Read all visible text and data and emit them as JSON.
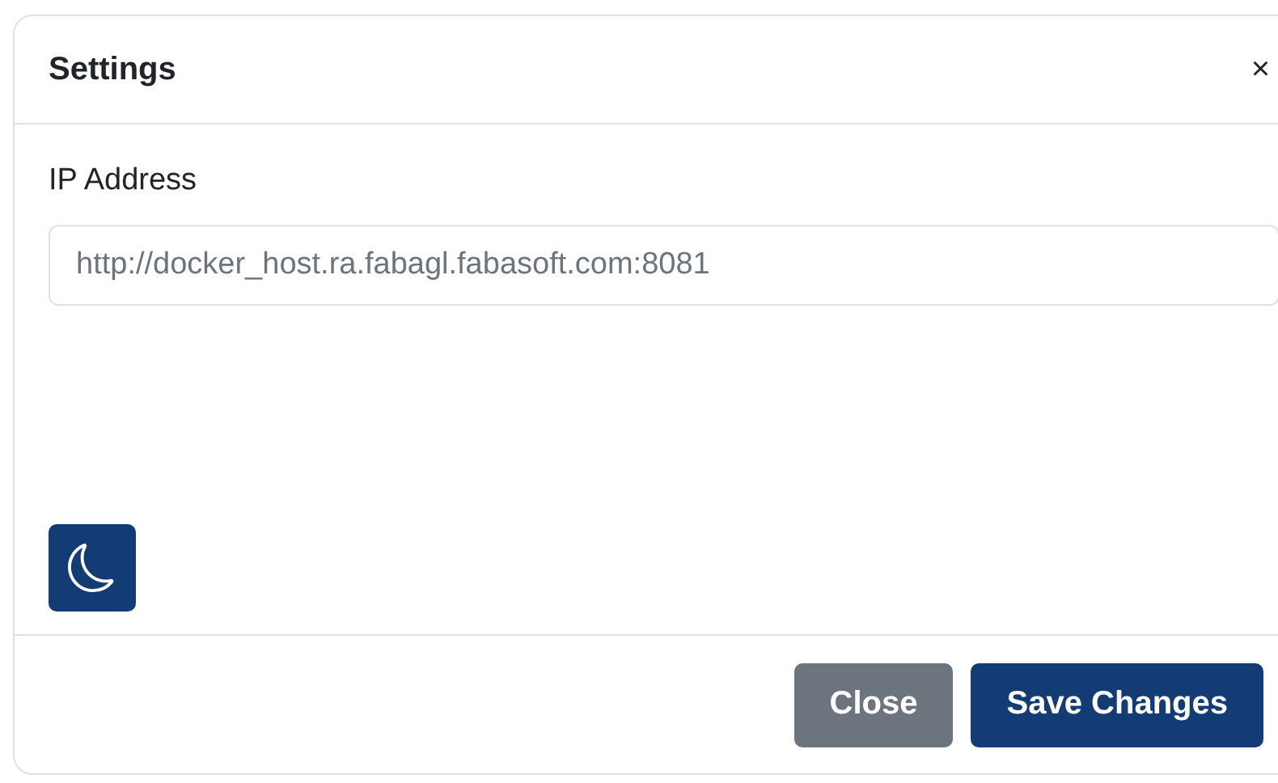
{
  "dialog": {
    "title": "Settings",
    "close_glyph": "×"
  },
  "ip_address": {
    "label": "IP Address",
    "placeholder": "http://docker_host.ra.fabagl.fabasoft.com:8081"
  },
  "buttons": [
    {
      "label": "Close",
      "kind": "secondary"
    },
    {
      "label": "Save Changes",
      "kind": "primary"
    }
  ]
}
